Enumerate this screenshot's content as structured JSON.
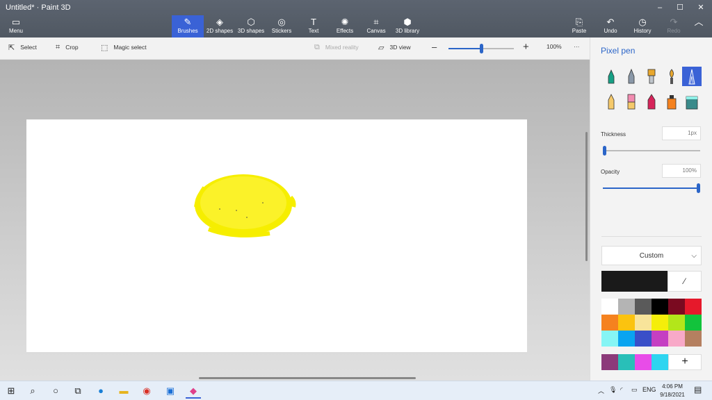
{
  "app": {
    "title": "Untitled* · Paint 3D",
    "window_controls": [
      "–",
      "☐",
      "✕"
    ]
  },
  "ribbon": {
    "menu_label": "Menu",
    "tools": [
      {
        "label": "Brushes",
        "icon": "brush-icon"
      },
      {
        "label": "2D shapes",
        "icon": "2d-shapes-icon"
      },
      {
        "label": "3D shapes",
        "icon": "3d-shapes-icon"
      },
      {
        "label": "Stickers",
        "icon": "stickers-icon"
      },
      {
        "label": "Text",
        "icon": "text-icon"
      },
      {
        "label": "Effects",
        "icon": "effects-icon"
      },
      {
        "label": "Canvas",
        "icon": "canvas-icon"
      },
      {
        "label": "3D library",
        "icon": "3d-library-icon"
      }
    ],
    "actions": [
      {
        "label": "Paste",
        "icon": "paste-icon"
      },
      {
        "label": "Undo",
        "icon": "undo-icon"
      },
      {
        "label": "History",
        "icon": "history-icon"
      },
      {
        "label": "Redo",
        "icon": "redo-icon"
      }
    ]
  },
  "toolbar": {
    "select_label": "Select",
    "crop_label": "Crop",
    "magic_select_label": "Magic select",
    "mixed_reality_label": "Mixed reality",
    "view3d_label": "3D view",
    "zoom_value": "100%",
    "more_label": "···"
  },
  "zoom_slider_level": 0.5,
  "panel": {
    "title": "Pixel pen",
    "brushes": [
      "marker",
      "calligraphy-pen",
      "oil-brush",
      "watercolor",
      "pixel-pen",
      "pencil",
      "eraser",
      "crayon",
      "spray-can",
      "fill"
    ],
    "selected_brush": "pixel-pen",
    "thickness_label": "Thickness",
    "thickness_value": "1px",
    "thickness_level": 0.0,
    "opacity_label": "Opacity",
    "opacity_value": "100%",
    "opacity_level": 1.0,
    "color_mode": "Custom",
    "current_color": "#1a1a1a",
    "palette": [
      "#ffffff",
      "#b4b4b4",
      "#5a5a5a",
      "#000000",
      "#7a0a20",
      "#e6192b",
      "#f5821f",
      "#fbc30f",
      "#f8e49a",
      "#f5ee0a",
      "#b3e61a",
      "#12c33c",
      "#86f5f5",
      "#09a4f0",
      "#3a4fc8",
      "#c53fc2",
      "#f8a9c8",
      "#b58060"
    ],
    "custom_colors": [
      "#8c3a7a",
      "#29bfb8",
      "#e84ce8",
      "#2ed5f0"
    ],
    "add_color_label": "+"
  },
  "taskbar": {
    "time": "4:06 PM",
    "date": "9/18/2021",
    "lang": "ENG",
    "apps": [
      "windows-start-icon",
      "search-icon",
      "cortana-icon",
      "task-view-icon",
      "edge-icon",
      "file-explorer-icon",
      "chrome-icon",
      "zalo-icon",
      "paint3d-icon"
    ]
  }
}
